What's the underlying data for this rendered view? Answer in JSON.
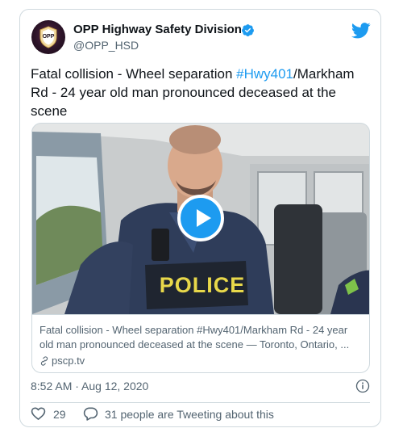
{
  "account": {
    "display_name": "OPP Highway Safety Division",
    "handle": "@OPP_HSD",
    "avatar_label": "OPP",
    "verified_icon": "verified-badge-icon",
    "platform_icon": "twitter-bird-icon"
  },
  "tweet": {
    "text_before": "Fatal collision - Wheel separation ",
    "hashtag": "#Hwy401",
    "text_after": "/Markham Rd - 24 year old man pronounced deceased at the scene"
  },
  "media": {
    "play_icon": "play-icon",
    "badge_text": "POLICE",
    "link_description_line1": "Fatal collision - Wheel separation #Hwy401/Markham Rd - 24 year",
    "link_description_line2": "old man pronounced deceased at the scene — Toronto, Ontario, ...",
    "link_domain": "pscp.tv"
  },
  "meta": {
    "timestamp": "8:52 AM · Aug 12, 2020",
    "like_count": "29",
    "replies_text": "31 people are Tweeting about this"
  },
  "colors": {
    "accent": "#1d9bf0",
    "text": "#0f1419",
    "secondary": "#536471",
    "border": "#cfd9de"
  }
}
